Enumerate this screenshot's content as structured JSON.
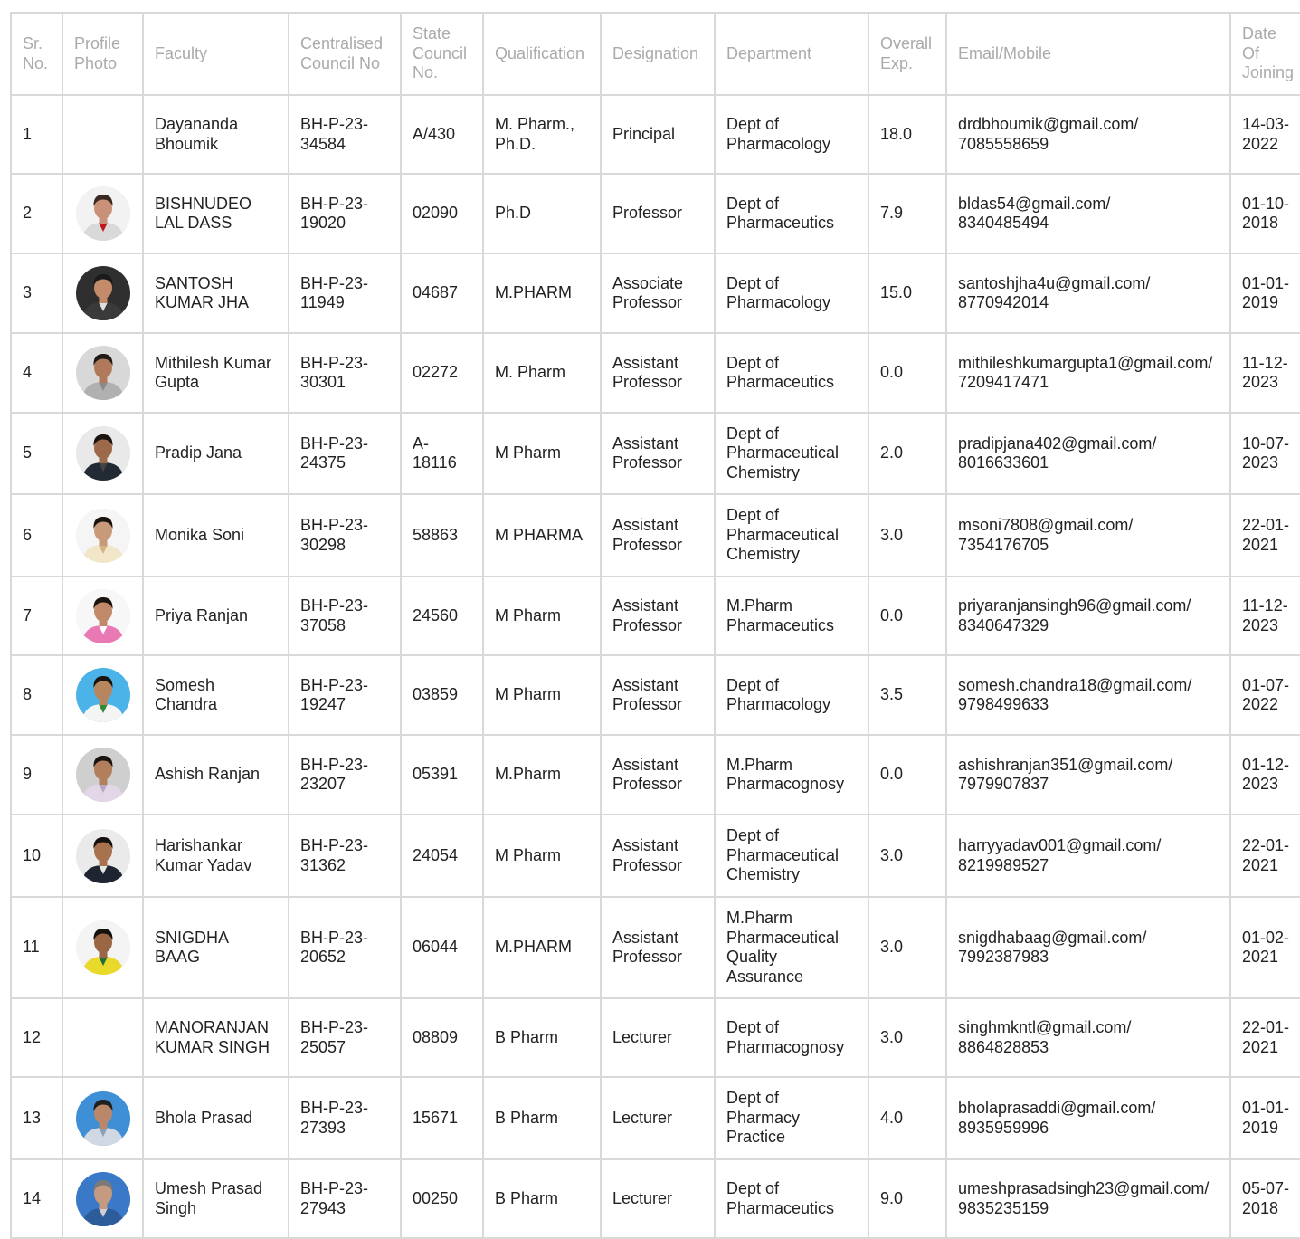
{
  "headers": [
    {
      "key": "sr",
      "label": "Sr.\nNo."
    },
    {
      "key": "photo",
      "label": "Profile\nPhoto"
    },
    {
      "key": "faculty",
      "label": "Faculty"
    },
    {
      "key": "ccn",
      "label": "Centralised\nCouncil No"
    },
    {
      "key": "scn",
      "label": "State\nCouncil\nNo."
    },
    {
      "key": "qual",
      "label": "Qualification"
    },
    {
      "key": "desig",
      "label": "Designation"
    },
    {
      "key": "dept",
      "label": "Department"
    },
    {
      "key": "exp",
      "label": "Overall\nExp."
    },
    {
      "key": "email",
      "label": "Email/Mobile"
    },
    {
      "key": "doj",
      "label": "Date\nOf\nJoining"
    }
  ],
  "rows": [
    {
      "sr": "1",
      "photo": false,
      "faculty": "Dayananda\nBhoumik",
      "ccn": "BH-P-23-\n34584",
      "scn": "A/430",
      "qual": "M. Pharm.,\nPh.D.",
      "desig": "Principal",
      "dept": "Dept of\nPharmacology",
      "exp": "18.0",
      "email": "drdbhoumik@gmail.com/\n7085558659",
      "doj": "14-03-\n2022"
    },
    {
      "sr": "2",
      "photo": true,
      "avatar": {
        "bg": "#f2f2f2",
        "skin": "#c99278",
        "hair": "#3a2a22",
        "shirt": "#d9d9d9",
        "accent": "#c0151b"
      },
      "faculty": "BISHNUDEO\nLAL DASS",
      "ccn": "BH-P-23-\n19020",
      "scn": "02090",
      "qual": "Ph.D",
      "desig": "Professor",
      "dept": "Dept of\nPharmaceutics",
      "exp": "7.9",
      "email": "bldas54@gmail.com/\n8340485494",
      "doj": "01-10-\n2018"
    },
    {
      "sr": "3",
      "photo": true,
      "avatar": {
        "bg": "#2f2f2f",
        "skin": "#c48b6a",
        "hair": "#1a1a1a",
        "shirt": "#3a3a3a",
        "accent": "#e0e0e0"
      },
      "faculty": "SANTOSH\nKUMAR JHA",
      "ccn": "BH-P-23-\n11949",
      "scn": "04687",
      "qual": "M.PHARM",
      "desig": "Associate\nProfessor",
      "dept": "Dept of\nPharmacology",
      "exp": "15.0",
      "email": "santoshjha4u@gmail.com/\n8770942014",
      "doj": "01-01-\n2019"
    },
    {
      "sr": "4",
      "photo": true,
      "avatar": {
        "bg": "#d8d8d8",
        "skin": "#b07a5a",
        "hair": "#1f1a18",
        "shirt": "#b0b0b0",
        "accent": "#8a8a8a"
      },
      "faculty": "Mithilesh Kumar\nGupta",
      "ccn": "BH-P-23-\n30301",
      "scn": "02272",
      "qual": "M. Pharm",
      "desig": "Assistant\nProfessor",
      "dept": "Dept of\nPharmaceutics",
      "exp": "0.0",
      "email": "mithileshkumargupta1@gmail.com/\n7209417471",
      "doj": "11-12-\n2023"
    },
    {
      "sr": "5",
      "photo": true,
      "avatar": {
        "bg": "#e9e9e9",
        "skin": "#9c6a4a",
        "hair": "#1a1410",
        "shirt": "#222a33",
        "accent": "#444444"
      },
      "faculty": "Pradip Jana",
      "ccn": "BH-P-23-\n24375",
      "scn": "A-\n18116",
      "qual": "M Pharm",
      "desig": "Assistant\nProfessor",
      "dept": "Dept of\nPharmaceutical\nChemistry",
      "exp": "2.0",
      "email": "pradipjana402@gmail.com/\n8016633601",
      "doj": "10-07-\n2023"
    },
    {
      "sr": "6",
      "photo": true,
      "avatar": {
        "bg": "#f5f5f5",
        "skin": "#c99a7a",
        "hair": "#1a1410",
        "shirt": "#f2e6c8",
        "accent": "#d4b483"
      },
      "faculty": "Monika Soni",
      "ccn": "BH-P-23-\n30298",
      "scn": "58863",
      "qual": "M PHARMA",
      "desig": "Assistant\nProfessor",
      "dept": "Dept of\nPharmaceutical\nChemistry",
      "exp": "3.0",
      "email": "msoni7808@gmail.com/\n7354176705",
      "doj": "22-01-\n2021"
    },
    {
      "sr": "7",
      "photo": true,
      "avatar": {
        "bg": "#f7f7f7",
        "skin": "#c08a6a",
        "hair": "#1a1410",
        "shirt": "#e879b4",
        "accent": "#ffffff"
      },
      "faculty": "Priya Ranjan",
      "ccn": "BH-P-23-\n37058",
      "scn": "24560",
      "qual": "M Pharm",
      "desig": "Assistant\nProfessor",
      "dept": "M.Pharm\nPharmaceutics",
      "exp": "0.0",
      "email": "priyaranjansingh96@gmail.com/\n8340647329",
      "doj": "11-12-\n2023"
    },
    {
      "sr": "8",
      "photo": true,
      "avatar": {
        "bg": "#4bb3e8",
        "skin": "#b8865e",
        "hair": "#1a1410",
        "shirt": "#f4f4f4",
        "accent": "#2f8a3a"
      },
      "faculty": "Somesh\nChandra",
      "ccn": "BH-P-23-\n19247",
      "scn": "03859",
      "qual": "M Pharm",
      "desig": "Assistant\nProfessor",
      "dept": "Dept of\nPharmacology",
      "exp": "3.5",
      "email": "somesh.chandra18@gmail.com/\n9798499633",
      "doj": "01-07-\n2022"
    },
    {
      "sr": "9",
      "photo": true,
      "avatar": {
        "bg": "#cfcfcf",
        "skin": "#b37e5c",
        "hair": "#1a1410",
        "shirt": "#e3d6e6",
        "accent": "#b7a7bf"
      },
      "faculty": "Ashish Ranjan",
      "ccn": "BH-P-23-\n23207",
      "scn": "05391",
      "qual": "M.Pharm",
      "desig": "Assistant\nProfessor",
      "dept": "M.Pharm\nPharmacognosy",
      "exp": "0.0",
      "email": "ashishranjan351@gmail.com/\n7979907837",
      "doj": "01-12-\n2023"
    },
    {
      "sr": "10",
      "photo": true,
      "avatar": {
        "bg": "#eaeaea",
        "skin": "#a8724f",
        "hair": "#16110e",
        "shirt": "#1e2530",
        "accent": "#e5e5e5"
      },
      "faculty": "Harishankar\nKumar Yadav",
      "ccn": "BH-P-23-\n31362",
      "scn": "24054",
      "qual": "M Pharm",
      "desig": "Assistant\nProfessor",
      "dept": "Dept of\nPharmaceutical\nChemistry",
      "exp": "3.0",
      "email": "harryyadav001@gmail.com/\n8219989527",
      "doj": "22-01-\n2021"
    },
    {
      "sr": "11",
      "photo": true,
      "avatar": {
        "bg": "#f4f4f4",
        "skin": "#9a6644",
        "hair": "#16110e",
        "shirt": "#e9d92a",
        "accent": "#1f6e3a"
      },
      "faculty": "SNIGDHA\nBAAG",
      "ccn": "BH-P-23-\n20652",
      "scn": "06044",
      "qual": "M.PHARM",
      "desig": "Assistant\nProfessor",
      "dept": "M.Pharm\nPharmaceutical\nQuality\nAssurance",
      "exp": "3.0",
      "email": "snigdhabaag@gmail.com/\n7992387983",
      "doj": "01-02-\n2021"
    },
    {
      "sr": "12",
      "photo": false,
      "faculty": "MANORANJAN\nKUMAR SINGH",
      "ccn": "BH-P-23-\n25057",
      "scn": "08809",
      "qual": "B Pharm",
      "desig": "Lecturer",
      "dept": "Dept of\nPharmacognosy",
      "exp": "3.0",
      "email": "singhmkntl@gmail.com/\n8864828853",
      "doj": "22-01-\n2021"
    },
    {
      "sr": "13",
      "photo": true,
      "avatar": {
        "bg": "#3f8fd6",
        "skin": "#b9886a",
        "hair": "#202020",
        "shirt": "#cfd8e3",
        "accent": "#8aa0b8"
      },
      "faculty": "Bhola Prasad",
      "ccn": "BH-P-23-\n27393",
      "scn": "15671",
      "qual": "B Pharm",
      "desig": "Lecturer",
      "dept": "Dept of\nPharmacy\nPractice",
      "exp": "4.0",
      "email": "bholaprasaddi@gmail.com/\n8935959996",
      "doj": "01-01-\n2019"
    },
    {
      "sr": "14",
      "photo": true,
      "avatar": {
        "bg": "#3a78c8",
        "skin": "#c49a80",
        "hair": "#7a7a7a",
        "shirt": "#2c5c9a",
        "accent": "#d0d0d0"
      },
      "faculty": "Umesh Prasad\nSingh",
      "ccn": "BH-P-23-\n27943",
      "scn": "00250",
      "qual": "B Pharm",
      "desig": "Lecturer",
      "dept": "Dept of\nPharmaceutics",
      "exp": "9.0",
      "email": "umeshprasadsingh23@gmail.com/\n9835235159",
      "doj": "05-07-\n2018"
    }
  ]
}
